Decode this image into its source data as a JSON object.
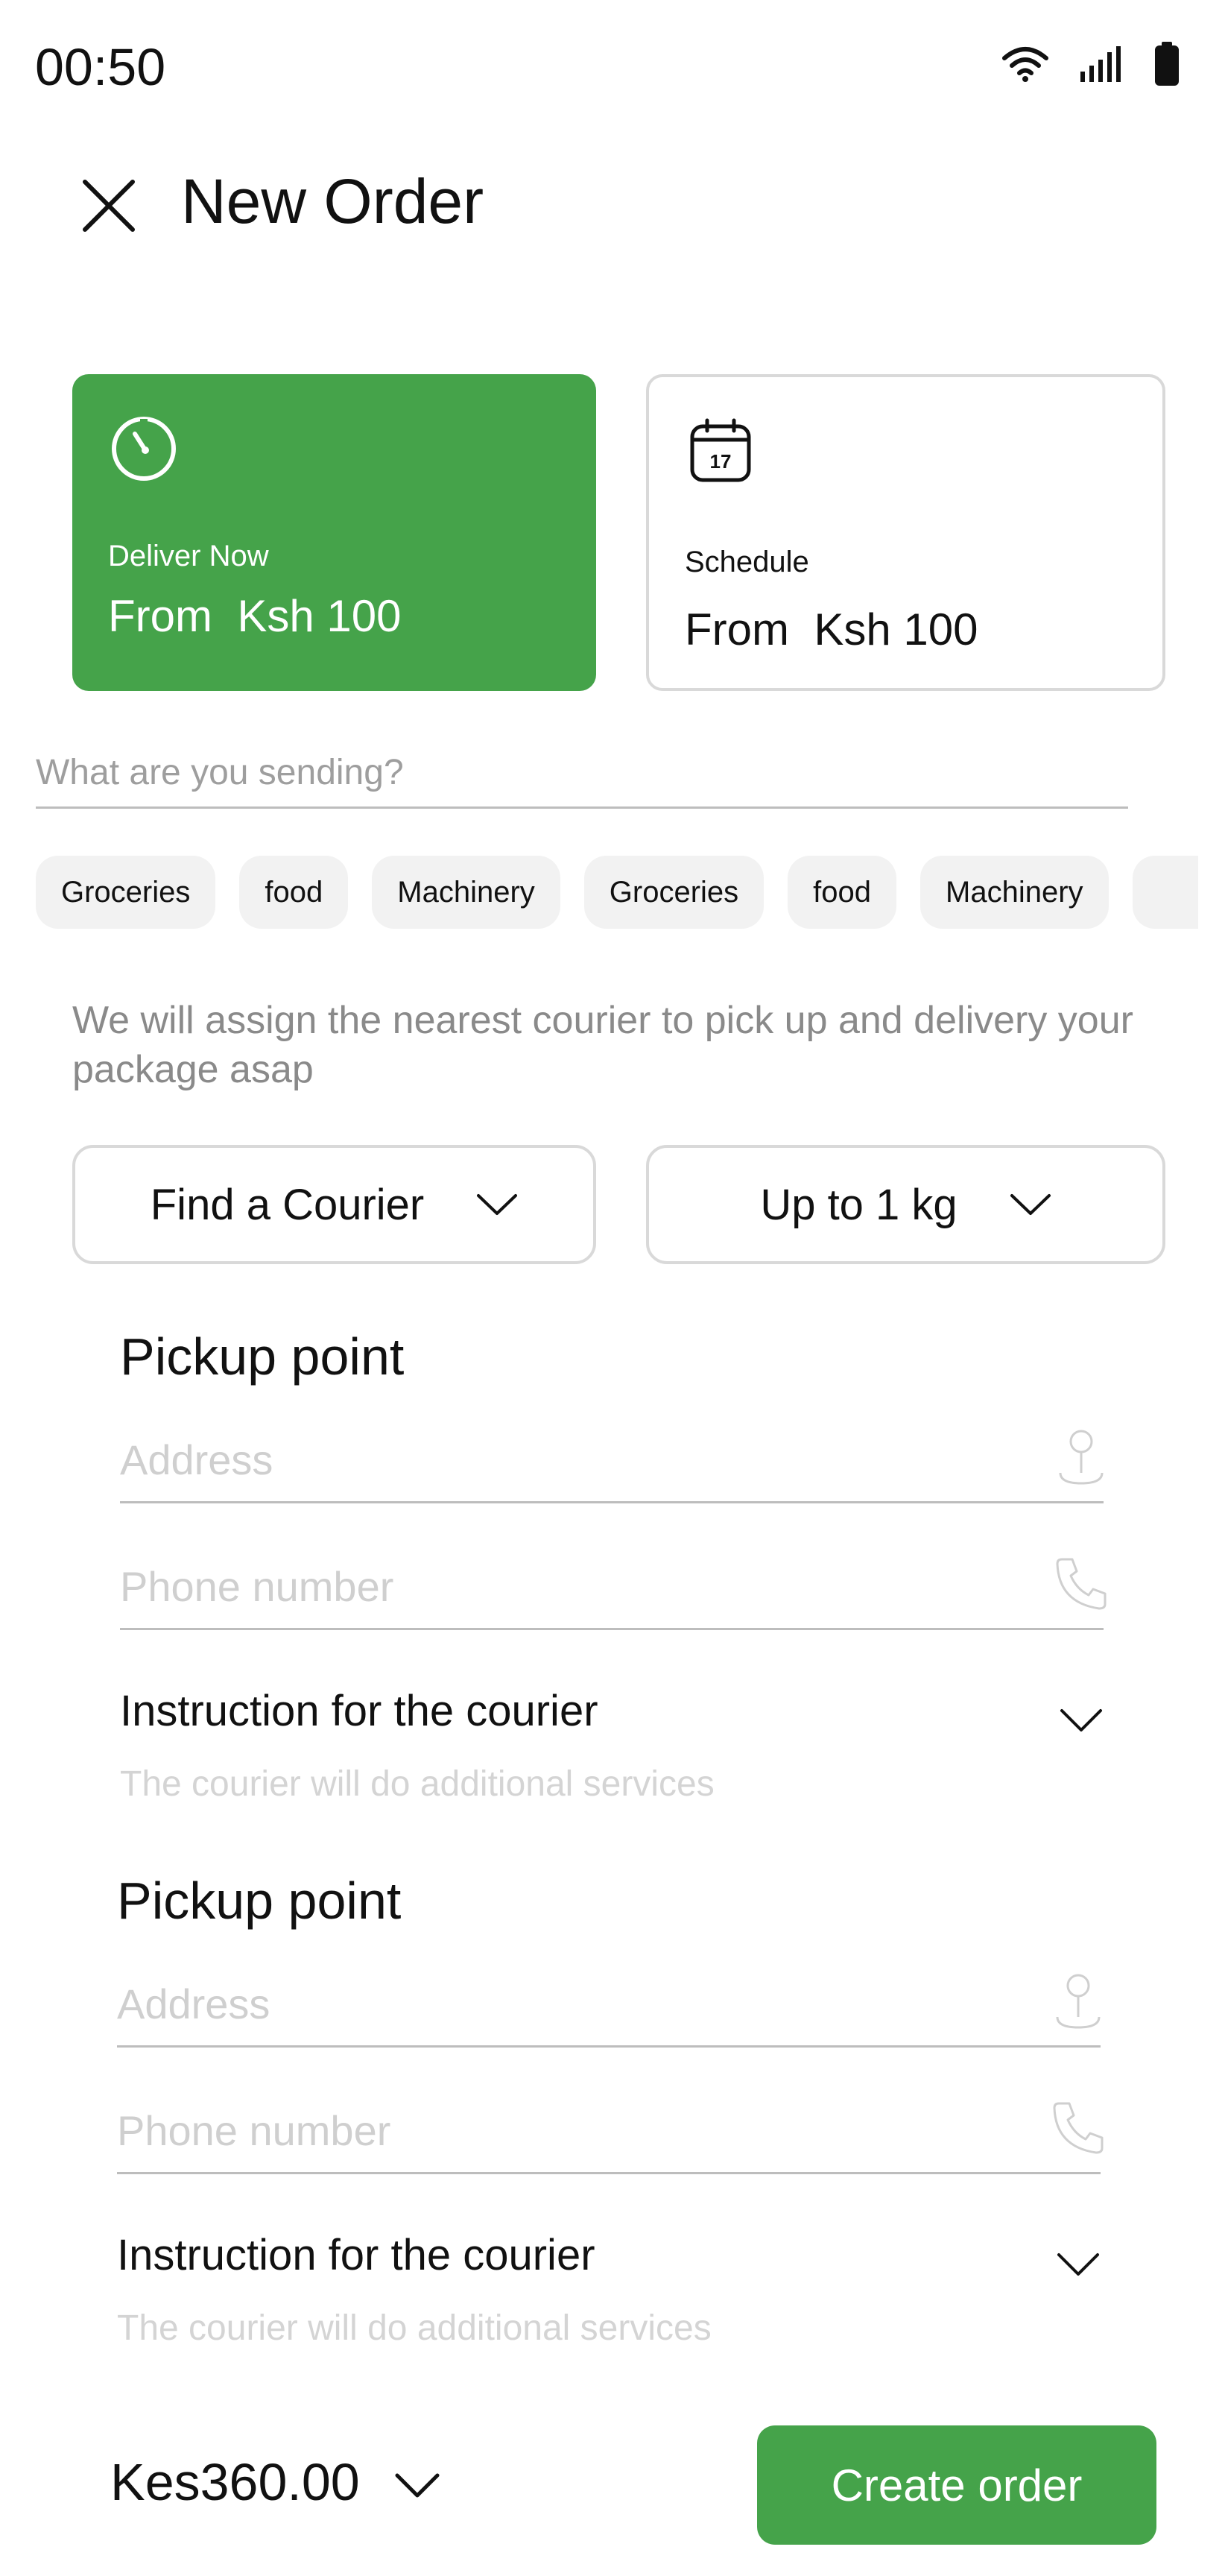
{
  "status_bar": {
    "time": "00:50",
    "icons": [
      "wifi-icon",
      "signal-icon",
      "battery-icon"
    ]
  },
  "header": {
    "title": "New Order",
    "close_icon": "close-icon"
  },
  "delivery_options": [
    {
      "label": "Deliver Now",
      "price": "From  Ksh 100",
      "icon": "timer-icon",
      "selected": true
    },
    {
      "label": "Schedule",
      "price": "From  Ksh 100",
      "icon": "calendar-icon",
      "calendar_day": "17",
      "selected": false
    }
  ],
  "sending": {
    "placeholder": "What are you sending?",
    "value": ""
  },
  "categories": [
    "Groceries",
    "food",
    "Machinery",
    "Groceries",
    "food",
    "Machinery",
    ""
  ],
  "info_text": "We will assign the nearest courier to pick up and delivery your package asap",
  "dropdowns": {
    "courier": "Find a Courier",
    "weight": "Up to 1 kg"
  },
  "pickup_sections": [
    {
      "title": "Pickup point",
      "address_placeholder": "Address",
      "phone_placeholder": "Phone number",
      "instruction_title": "Instruction for the courier",
      "instruction_sub": "The courier will do additional services"
    },
    {
      "title": "Pickup point",
      "address_placeholder": "Address",
      "phone_placeholder": "Phone number",
      "instruction_title": "Instruction for the courier",
      "instruction_sub": "The courier will do additional services"
    }
  ],
  "footer": {
    "total": "Kes360.00",
    "create_label": "Create order"
  },
  "colors": {
    "accent": "#45A34A",
    "border": "#D9D9D9",
    "chip_bg": "#F2F2F2",
    "muted_text": "#8A8A8A",
    "placeholder": "#CFCFCF"
  }
}
